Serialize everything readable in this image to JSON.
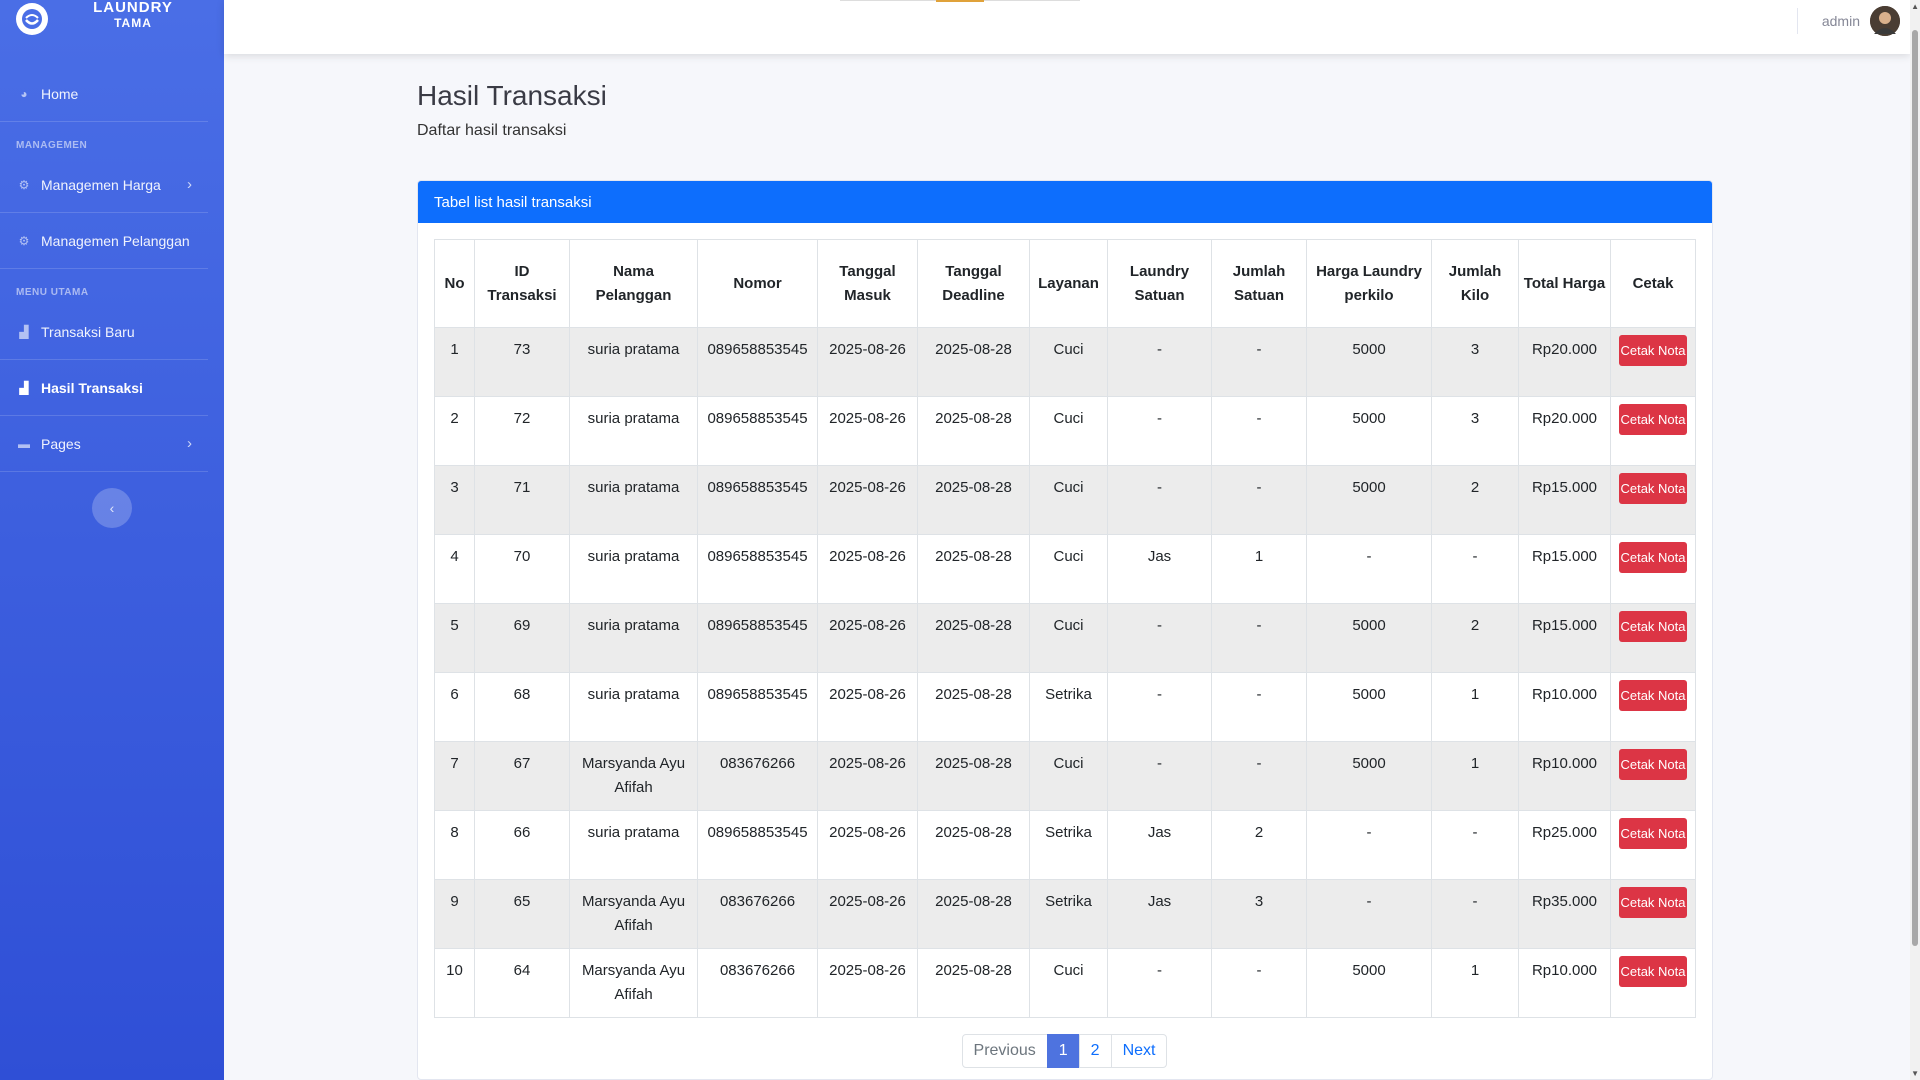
{
  "brand": {
    "line1": "LAUNDRY",
    "line2": "TAMA",
    "logo_icon": "smile-logo-icon"
  },
  "sidebar": {
    "home": "Home",
    "section_management": "MANAGEMEN",
    "management_items": [
      "Managemen Harga",
      "Managemen Pelanggan"
    ],
    "section_main": "MENU UTAMA",
    "main_items": [
      "Transaksi Baru",
      "Hasil Transaksi"
    ],
    "pages": "Pages",
    "active_item": "Hasil Transaksi"
  },
  "topbar": {
    "user_name": "admin"
  },
  "page": {
    "title": "Hasil Transaksi",
    "subtitle": "Daftar hasil transaksi",
    "card_title": "Tabel list hasil transaksi"
  },
  "table": {
    "headers": [
      "No",
      "ID Transaksi",
      "Nama Pelanggan",
      "Nomor",
      "Tanggal Masuk",
      "Tanggal Deadline",
      "Layanan",
      "Laundry Satuan",
      "Jumlah Satuan",
      "Harga Laundry perkilo",
      "Jumlah Kilo",
      "Total Harga",
      "Cetak"
    ],
    "action_label": "Cetak Nota",
    "rows": [
      [
        "1",
        "73",
        "suria pratama",
        "089658853545",
        "2025-08-26",
        "2025-08-28",
        "Cuci",
        "-",
        "-",
        "5000",
        "3",
        "Rp20.000"
      ],
      [
        "2",
        "72",
        "suria pratama",
        "089658853545",
        "2025-08-26",
        "2025-08-28",
        "Cuci",
        "-",
        "-",
        "5000",
        "3",
        "Rp20.000"
      ],
      [
        "3",
        "71",
        "suria pratama",
        "089658853545",
        "2025-08-26",
        "2025-08-28",
        "Cuci",
        "-",
        "-",
        "5000",
        "2",
        "Rp15.000"
      ],
      [
        "4",
        "70",
        "suria pratama",
        "089658853545",
        "2025-08-26",
        "2025-08-28",
        "Cuci",
        "Jas",
        "1",
        "-",
        "-",
        "Rp15.000"
      ],
      [
        "5",
        "69",
        "suria pratama",
        "089658853545",
        "2025-08-26",
        "2025-08-28",
        "Cuci",
        "-",
        "-",
        "5000",
        "2",
        "Rp15.000"
      ],
      [
        "6",
        "68",
        "suria pratama",
        "089658853545",
        "2025-08-26",
        "2025-08-28",
        "Setrika",
        "-",
        "-",
        "5000",
        "1",
        "Rp10.000"
      ],
      [
        "7",
        "67",
        "Marsyanda Ayu Afifah",
        "083676266",
        "2025-08-26",
        "2025-08-28",
        "Cuci",
        "-",
        "-",
        "5000",
        "1",
        "Rp10.000"
      ],
      [
        "8",
        "66",
        "suria pratama",
        "089658853545",
        "2025-08-26",
        "2025-08-28",
        "Setrika",
        "Jas",
        "2",
        "-",
        "-",
        "Rp25.000"
      ],
      [
        "9",
        "65",
        "Marsyanda Ayu Afifah",
        "083676266",
        "2025-08-26",
        "2025-08-28",
        "Setrika",
        "Jas",
        "3",
        "-",
        "-",
        "Rp35.000"
      ],
      [
        "10",
        "64",
        "Marsyanda Ayu Afifah",
        "083676266",
        "2025-08-26",
        "2025-08-28",
        "Cuci",
        "-",
        "-",
        "5000",
        "1",
        "Rp10.000"
      ]
    ]
  },
  "pagination": {
    "previous": "Previous",
    "pages": [
      "1",
      "2"
    ],
    "current": "1",
    "next": "Next"
  },
  "colors": {
    "sidebar_top": "#4a6ee6",
    "sidebar_bottom": "#2f4fd6",
    "card_header": "#0d6efd",
    "print_button": "#dc3545",
    "current_page": "#4e73df"
  }
}
